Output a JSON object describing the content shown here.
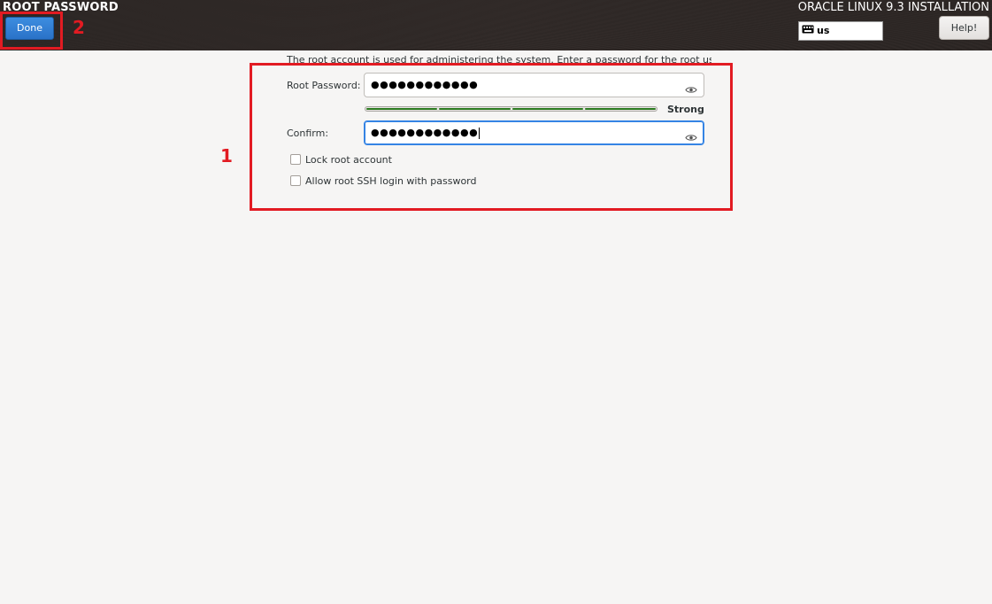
{
  "header": {
    "page_title": "ROOT PASSWORD",
    "done_label": "Done",
    "product_title": "ORACLE LINUX 9.3 INSTALLATION",
    "keyboard_layout": "us",
    "help_label": "Help!"
  },
  "form": {
    "intro_text": "The root account is used for administering the system.  Enter a password for the root user.",
    "root_password_label": "Root Password:",
    "root_password_value": "●●●●●●●●●●●●",
    "strength_label": "Strong",
    "strength_level": 1.0,
    "confirm_label": "Confirm:",
    "confirm_value": "●●●●●●●●●●●●",
    "lock_root_label": "Lock root account",
    "lock_root_checked": false,
    "allow_ssh_label": "Allow root SSH login with password",
    "allow_ssh_checked": false
  },
  "annotations": {
    "label_1": "1",
    "label_2": "2",
    "color": "#e21b22"
  },
  "colors": {
    "done_button": "#2a72c8",
    "focus_border": "#3584e4",
    "strength_green": "#2a7a1e"
  }
}
